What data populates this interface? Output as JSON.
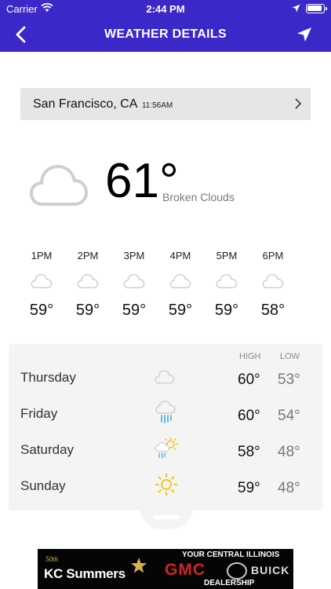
{
  "status_bar": {
    "carrier": "Carrier",
    "time": "2:44 PM"
  },
  "nav": {
    "title": "WEATHER DETAILS"
  },
  "location": {
    "city": "San Francisco, CA",
    "time": "11:56AM"
  },
  "current": {
    "temp": "61°",
    "condition": "Broken Clouds",
    "icon": "cloud-icon"
  },
  "hourly": [
    {
      "time": "1PM",
      "temp": "59°",
      "icon": "cloud-icon"
    },
    {
      "time": "2PM",
      "temp": "59°",
      "icon": "cloud-icon"
    },
    {
      "time": "3PM",
      "temp": "59°",
      "icon": "cloud-icon"
    },
    {
      "time": "4PM",
      "temp": "59°",
      "icon": "cloud-icon"
    },
    {
      "time": "5PM",
      "temp": "59°",
      "icon": "cloud-icon"
    },
    {
      "time": "6PM",
      "temp": "58°",
      "icon": "cloud-icon"
    }
  ],
  "daily": {
    "high_label": "HIGH",
    "low_label": "LOW",
    "days": [
      {
        "name": "Thursday",
        "high": "60°",
        "low": "53°",
        "icon": "cloud-icon"
      },
      {
        "name": "Friday",
        "high": "60°",
        "low": "54°",
        "icon": "rain-cloud-icon"
      },
      {
        "name": "Saturday",
        "high": "58°",
        "low": "48°",
        "icon": "sun-rain-icon"
      },
      {
        "name": "Sunday",
        "high": "59°",
        "low": "48°",
        "icon": "sun-icon"
      }
    ]
  },
  "ad": {
    "anniversary": "50th",
    "brand": "KC Summers",
    "tagline": "YOUR CENTRAL ILLINOIS",
    "gmc": "GMC",
    "buick": "BUICK",
    "dealership": "DEALERSHIP"
  },
  "colors": {
    "nav_bg": "#3b28c9",
    "sun": "#f4c20d",
    "rain": "#6fb6e8",
    "cloud": "#cfcfcf"
  }
}
